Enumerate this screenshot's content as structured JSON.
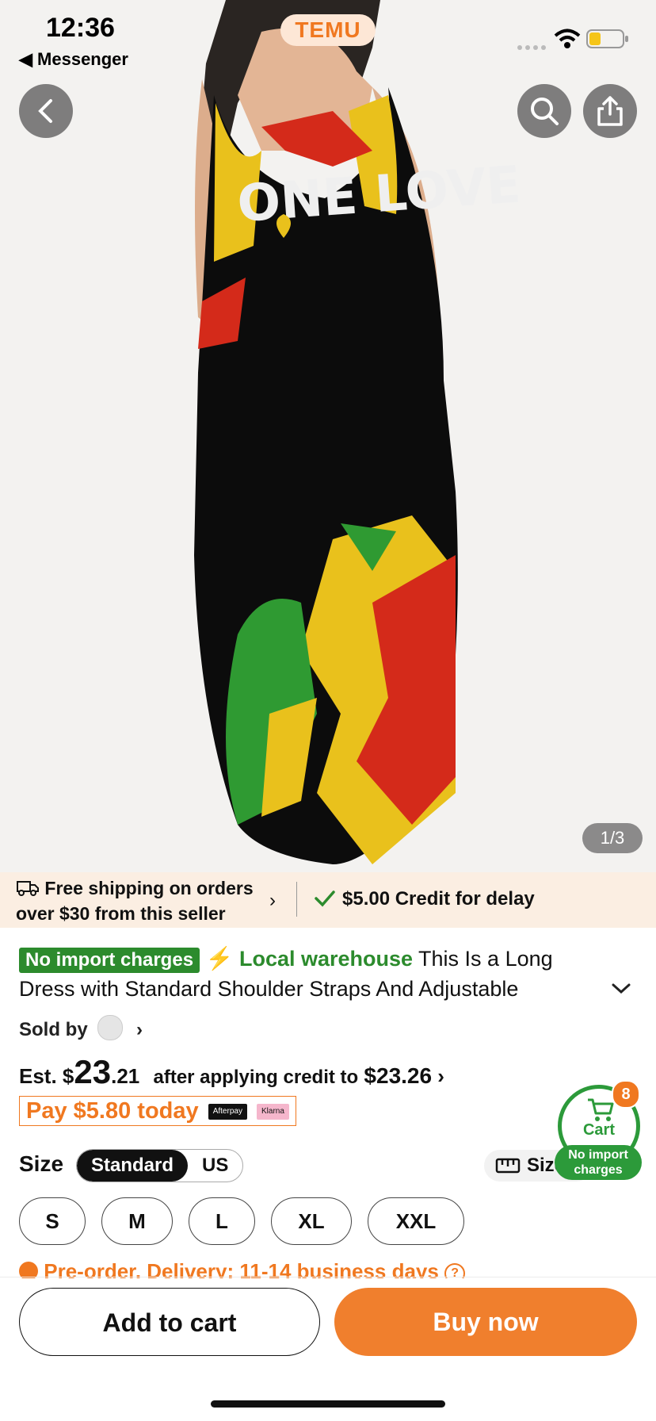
{
  "status_bar": {
    "time": "12:36",
    "back_app": "Messenger"
  },
  "header": {
    "logo": "TEMU"
  },
  "image_counter": "1/3",
  "product_print_text": "ONE LOVE",
  "shipping": {
    "line1": "Free shipping on orders",
    "line2": "over $30 from this seller",
    "credit": "$5.00 Credit for delay"
  },
  "product": {
    "badge": "No import charges",
    "warehouse": "Local warehouse",
    "title_start": "This Is a Long",
    "title_line2": "Dress with Standard Shoulder Straps And Adjustable",
    "sold_by": "Sold by"
  },
  "price": {
    "est_label": "Est. $",
    "dollars": "23",
    "cents": ".21",
    "credit_note": "after applying credit to",
    "original": "$23.26"
  },
  "pay_today": {
    "text": "Pay $5.80 today",
    "afterpay": "Afterpay",
    "klarna": "Klarna"
  },
  "size": {
    "label": "Size",
    "systems": [
      "Standard",
      "US"
    ],
    "guide": "Size",
    "options": [
      "S",
      "M",
      "L",
      "XL",
      "XXL"
    ]
  },
  "preorder": "Pre-order. Delivery: 11-14 business days",
  "cart": {
    "label": "Cart",
    "count": "8",
    "badge": "No import charges"
  },
  "actions": {
    "add_to_cart": "Add to cart",
    "buy_now": "Buy now"
  },
  "colors": {
    "accent": "#f07820",
    "green": "#2c8b2d"
  }
}
